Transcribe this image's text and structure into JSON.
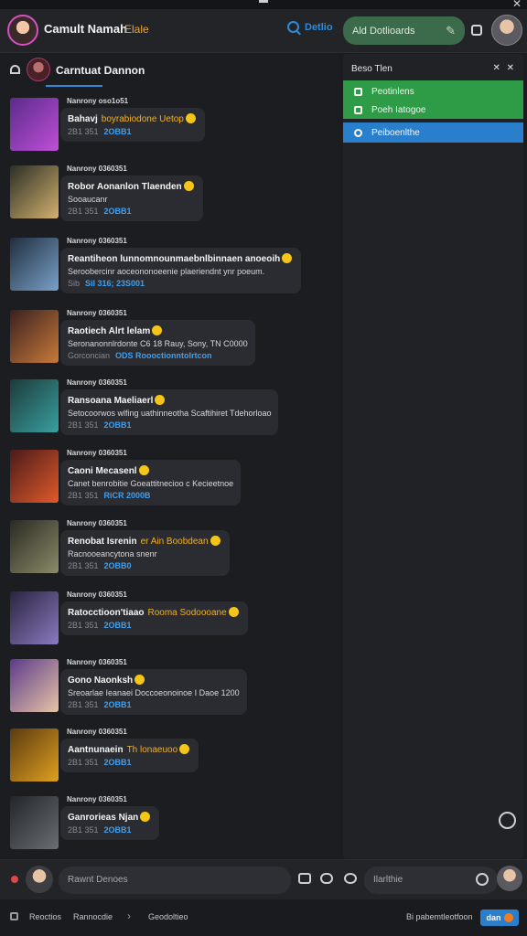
{
  "window": {
    "close_glyph": "✕"
  },
  "header": {
    "username": "Camult Namah",
    "status": "Elale",
    "search_label": "Detlio",
    "pill_label": "Ald Dotlioards",
    "icons": [
      "avatar",
      "search-icon",
      "wrench-icon",
      "shield-icon",
      "profile-avatar"
    ]
  },
  "chat": {
    "title": "Carntuat Dannon",
    "messages": [
      {
        "meta": "Nanrony oso1o51",
        "line1": "Bahavj",
        "line1_hl": "boyrabiodone Uetop",
        "line2": "",
        "line3a": "2B1 351",
        "line3b": "2OBB1",
        "thumb": [
          "#5a2b8a",
          "#c04fd8"
        ]
      },
      {
        "meta": "Nanrony 0360351",
        "line1": "Robor Aonanlon Tlaenden",
        "line1_hl": "",
        "line2": "Sooaucanr",
        "line3a": "2B1 351",
        "line3b": "2OBB1",
        "thumb": [
          "#2a2f24",
          "#d4b070"
        ]
      },
      {
        "meta": "Nanrony 0360351",
        "line1": "Reantiheon lunnomnounmaebnlbinnaen anoeoih",
        "line1_hl": "",
        "line2": "Seroobercinr aoceononoeenie plaeriendnt ynr poeum.",
        "line3a": "Sib",
        "line3b": "Sil 316; 23S001",
        "thumb": [
          "#1f2e3e",
          "#7aa0c8"
        ]
      },
      {
        "meta": "Nanrony 0360351",
        "line1": "Raotiech Alrt lelam",
        "line1_hl": "",
        "line2": "Seronanonnlrdonte C6 18  Rauy, Sony, TN C0000",
        "line3a": "Gorconcian",
        "line3b": "ODS  Roooctionntolrtcon",
        "thumb": [
          "#3a2020",
          "#c87a3a"
        ]
      },
      {
        "meta": "Nanrony 0360351",
        "line1": "Ransoana Maeliaerl",
        "line1_hl": "",
        "line2": "Setocoorwos wlfing uathinneotha   Scaftihiret Tdehorloao",
        "line3a": "2B1 351",
        "line3b": "2OBB1",
        "thumb": [
          "#1d3a3a",
          "#3aa0a0"
        ]
      },
      {
        "meta": "Nanrony 0360351",
        "line1": "Caoni Mecasenl",
        "line1_hl": "",
        "line2": "Canet benrobitie  Goeattitnecioo c Kecieetnoe",
        "line3a": "2B1 351",
        "line3b": "RiCR 2000B",
        "thumb": [
          "#4a1a1a",
          "#e05a2a"
        ]
      },
      {
        "meta": "Nanrony 0360351",
        "line1": "Renobat Isrenin",
        "line1_hl": "er  Ain  Boobdean",
        "line2": "Racnooeancytona snenr",
        "line3a": "2B1 351",
        "line3b": "2OBB0",
        "thumb": [
          "#2a2a22",
          "#8a8a6a"
        ]
      },
      {
        "meta": "Nanrony 0360351",
        "line1": "Ratocctioon'tiaao",
        "line1_hl": "Rooma    Sodoooane",
        "line2": "",
        "line3a": "2B1 351",
        "line3b": "2OBB1",
        "thumb": [
          "#2a2440",
          "#8a7ac0"
        ]
      },
      {
        "meta": "Nanrony 0360351",
        "line1": "Gono Naonksh",
        "line1_hl": "",
        "line2": "Sreoarlae  Ieanaei  Doccoeonoinoe  I Daoe 1200",
        "line3a": "2B1 351",
        "line3b": "2OBB1",
        "thumb": [
          "#5a3a8a",
          "#e8c4a6"
        ]
      },
      {
        "meta": "Nanrony 0360351",
        "line1": "Aantnunaein",
        "line1_hl": "Th lonaeuoo",
        "line2": "",
        "line3a": "2B1 351",
        "line3b": "2OBB1",
        "thumb": [
          "#5a3a10",
          "#e0a020"
        ]
      },
      {
        "meta": "Nanrony 0360351",
        "line1": "Ganrorieas Njan",
        "line1_hl": "",
        "line2": "",
        "line3a": "2B1 351",
        "line3b": "2OBB1",
        "thumb": [
          "#22262a",
          "#6a6e72"
        ]
      }
    ]
  },
  "side": {
    "title": "Beso Tlen",
    "close": "✕ ✕",
    "rows": [
      "Peotinlens",
      "Poeh Iatogoe"
    ],
    "active_row": "Peiboenlthe"
  },
  "composer": {
    "placeholder": "Rawnt Denoes",
    "placeholder2": "Ilarlthie"
  },
  "footer": {
    "item1": "Reoctios",
    "item2": "Rannocdie",
    "item3": "Geodoltieo",
    "right_text": "Bi pabemtleotfoon",
    "badge": "dan"
  }
}
